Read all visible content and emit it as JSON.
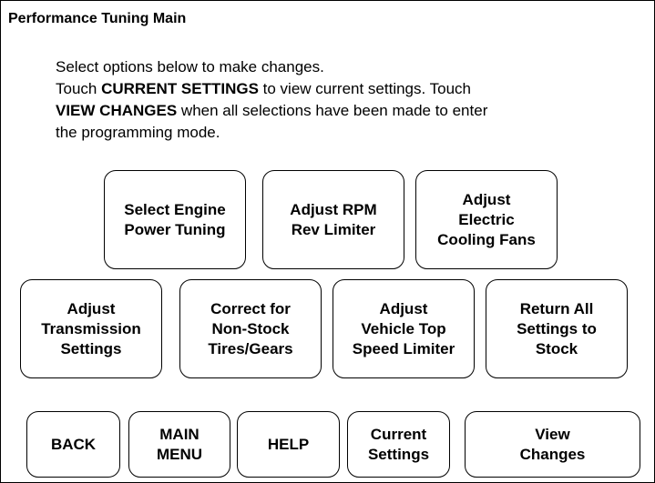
{
  "screen": {
    "title": "Performance Tuning Main"
  },
  "instructions": {
    "line1": "Select options below to make changes.",
    "touch1": "Touch ",
    "current_settings_bold": "CURRENT SETTINGS",
    "line2_rest": " to view current settings. Touch",
    "view_changes_bold": "VIEW CHANGES",
    "line3_rest": " when all selections have been made to enter",
    "line4": "the programming mode."
  },
  "options": {
    "engine_power": "Select Engine\nPower Tuning",
    "rpm_limiter": "Adjust RPM\nRev Limiter",
    "cooling_fans": "Adjust\nElectric\nCooling Fans",
    "transmission": "Adjust\nTransmission\nSettings",
    "tires_gears": "Correct for\nNon-Stock\nTires/Gears",
    "top_speed": "Adjust\nVehicle Top\nSpeed Limiter",
    "return_stock": "Return All\nSettings to\nStock"
  },
  "nav": {
    "back": "BACK",
    "main_menu": "MAIN\nMENU",
    "help": "HELP",
    "current_settings": "Current\nSettings",
    "view_changes": "View\nChanges"
  }
}
